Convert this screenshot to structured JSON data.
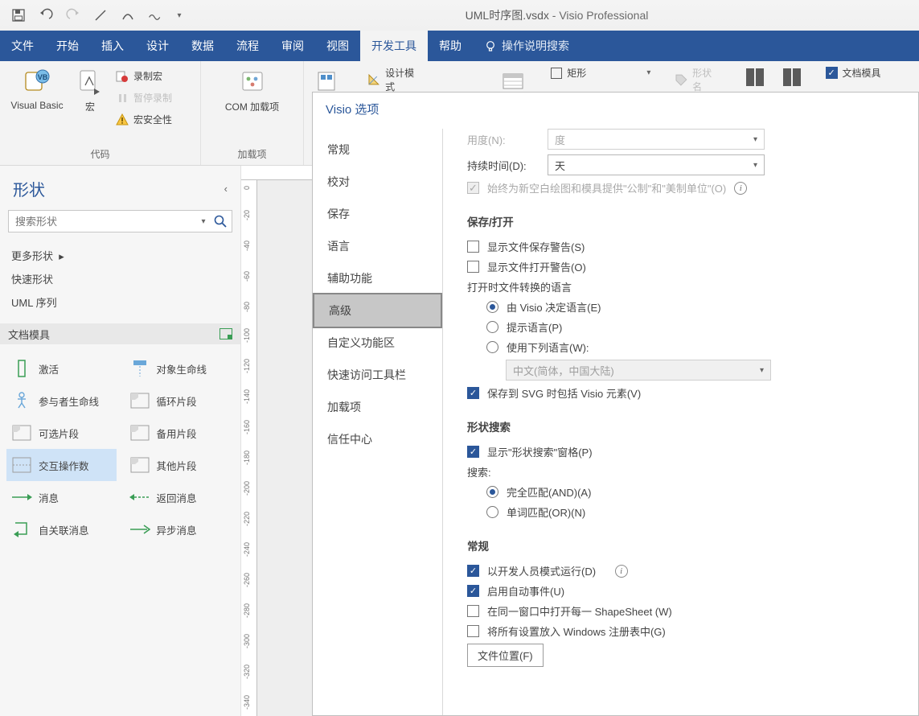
{
  "title": {
    "filename": "UML时序图.vsdx",
    "app": "Visio Professional",
    "sep": " - "
  },
  "tabs": {
    "file": "文件",
    "home": "开始",
    "insert": "插入",
    "design": "设计",
    "data": "数据",
    "process": "流程",
    "review": "审阅",
    "view": "视图",
    "developer": "开发工具",
    "help": "帮助",
    "tellme": "操作说明搜索"
  },
  "ribbon": {
    "code_group": "代码",
    "addins_group": "加载项",
    "vb": "Visual Basic",
    "macros": "宏",
    "record_macro": "录制宏",
    "pause_record": "暂停录制",
    "macro_security": "宏安全性",
    "com_addins": "COM 加载项",
    "design_mode": "设计模式",
    "rectangle": "矩形",
    "shape_name": "形状名",
    "doc_stencil": "文档模具"
  },
  "shapes": {
    "title": "形状",
    "search_placeholder": "搜索形状",
    "more": "更多形状",
    "quick": "快速形状",
    "uml_seq": "UML 序列",
    "doc_stencil": "文档模具",
    "items": {
      "activate": "激活",
      "lifeline": "对象生命线",
      "actor_lifeline": "参与者生命线",
      "loop": "循环片段",
      "opt": "可选片段",
      "alt": "备用片段",
      "interaction": "交互操作数",
      "other": "其他片段",
      "message": "消息",
      "return": "返回消息",
      "self": "自关联消息",
      "async": "异步消息"
    }
  },
  "ruler_v": [
    "0",
    "-20",
    "-40",
    "-60",
    "-80",
    "-100",
    "-120",
    "-140",
    "-160",
    "-180",
    "-200",
    "-220",
    "-240",
    "-260",
    "-280",
    "-300",
    "-320",
    "-340"
  ],
  "dialog": {
    "title": "Visio 选项",
    "nav": {
      "general": "常规",
      "proofing": "校对",
      "save": "保存",
      "language": "语言",
      "ease": "辅助功能",
      "advanced": "高级",
      "customize_ribbon": "自定义功能区",
      "qat": "快速访问工具栏",
      "addins": "加载项",
      "trust": "信任中心"
    },
    "top": {
      "angle_lbl": "用度(N):",
      "angle_val": "度",
      "duration_lbl": "持续时间(D):",
      "duration_val": "天",
      "always_metric": "始终为新空白绘图和模具提供\"公制\"和\"美制单位\"(O)"
    },
    "save_open": {
      "title": "保存/打开",
      "show_save_warn": "显示文件保存警告(S)",
      "show_open_warn": "显示文件打开警告(O)",
      "convert_lang": "打开时文件转换的语言",
      "by_visio": "由 Visio 决定语言(E)",
      "prompt": "提示语言(P)",
      "use_lang": "使用下列语言(W):",
      "lang_value": "中文(简体，中国大陆)",
      "svg": "保存到 SVG 时包括 Visio 元素(V)"
    },
    "shape_search": {
      "title": "形状搜索",
      "show_pane": "显示\"形状搜索\"窗格(P)",
      "search_lbl": "搜索:",
      "and": "完全匹配(AND)(A)",
      "or": "单词匹配(OR)(N)"
    },
    "general": {
      "title": "常规",
      "dev_mode": "以开发人员模式运行(D)",
      "auto_events": "启用自动事件(U)",
      "same_window": "在同一窗口中打开每一 ShapeSheet (W)",
      "registry": "将所有设置放入 Windows 注册表中(G)",
      "file_loc": "文件位置(F)"
    }
  }
}
